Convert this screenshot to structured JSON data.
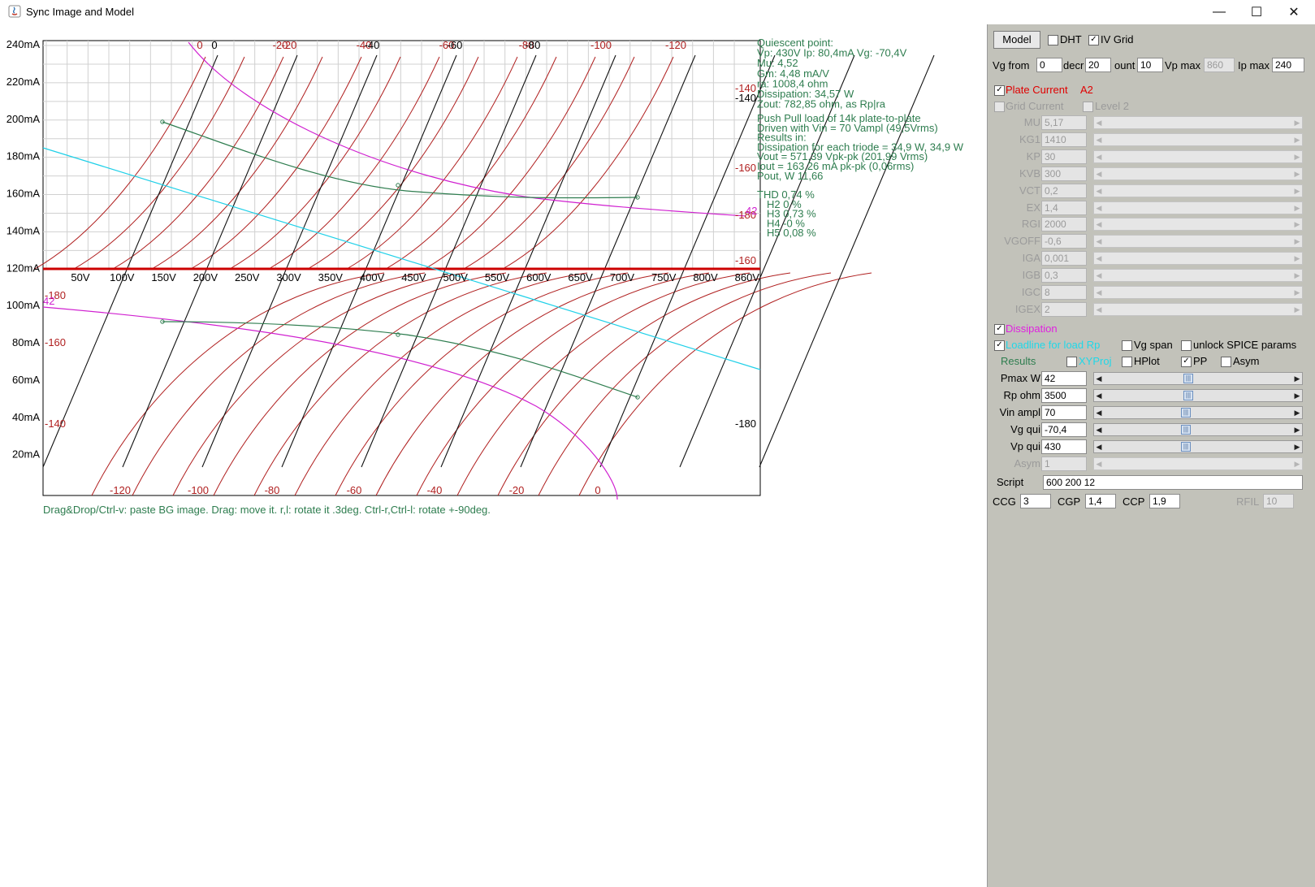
{
  "window": {
    "title": "Sync Image and Model",
    "minimize_label": "—",
    "maximize_label": "☐",
    "close_label": "✕"
  },
  "chart": {
    "y_ticks": [
      "240mA",
      "220mA",
      "200mA",
      "180mA",
      "160mA",
      "140mA",
      "120mA",
      "100mA",
      "80mA",
      "60mA",
      "40mA",
      "20mA"
    ],
    "x_ticks": [
      "50V",
      "100V",
      "150V",
      "200V",
      "250V",
      "300V",
      "350V",
      "400V",
      "450V",
      "500V",
      "550V",
      "600V",
      "650V",
      "700V",
      "750V",
      "800V",
      "860V"
    ],
    "top_curve_labels": [
      "0",
      "0",
      "-20",
      "-20",
      "-40",
      "-40",
      "-60",
      "-60",
      "-80",
      "-80",
      "-100",
      "-120"
    ],
    "right_curve_labels": [
      "-140",
      "-140",
      "-160",
      "-180",
      "-160",
      "-180"
    ],
    "right_magenta_label": "42",
    "bottom_curve_labels": [
      "-120",
      "-100",
      "-80",
      "-60",
      "-40",
      "-20",
      "0"
    ],
    "left_curve_labels": [
      "-180",
      "-160",
      "-140"
    ],
    "left_magenta_label": "42",
    "info_lines": [
      "Quiescent point:",
      "Vp: 430V  Ip: 80,4mA  Vg: -70,4V",
      "Mu: 4,52",
      "Gm: 4,48 mA/V",
      "ra: 1008,4 ohm",
      "Dissipation: 34,57 W",
      "Zout: 782,85 ohm, as Rp|ra"
    ],
    "pp_lines": [
      "Push Pull load of 14k plate-to-plate",
      "Driven with Vin = 70 Vampl (49,5Vrms)",
      "Results in:",
      "Dissipation for each triode = 34,9 W, 34,9 W",
      "Vout = 571,39 Vpk-pk (201,99 Vrms)",
      "Iout = 163,26 mA pk-pk (0,06rms)",
      "Pout, W        11,66"
    ],
    "thd_lines": [
      "THD 0,74 %",
      "H2 0 %",
      "H3 0,73 %",
      "H4 -0 %",
      "H5 0,08 %"
    ],
    "status_text": "Drag&Drop/Ctrl-v: paste BG image. Drag: move it. r,l: rotate it .3deg. Ctrl-r,Ctrl-l: rotate +-90deg."
  },
  "panel": {
    "model_button": "Model",
    "dht_label": "DHT",
    "dht_checked": false,
    "ivgrid_label": "IV Grid",
    "ivgrid_checked": true,
    "vg_from_label": "Vg from",
    "vg_from_value": "0",
    "decr_label": "decr",
    "decr_value": "20",
    "count_label": "ount",
    "count_value": "10",
    "vp_max_label": "Vp max",
    "vp_max_value": "860",
    "ip_max_label": "Ip max",
    "ip_max_value": "240",
    "plate_current_label": "Plate Current",
    "plate_current_checked": true,
    "plate_current_tube": "A2",
    "grid_current_label": "Grid Current",
    "level2_label": "Level 2",
    "params": [
      {
        "name": "MU",
        "value": "5,17"
      },
      {
        "name": "KG1",
        "value": "1410"
      },
      {
        "name": "KP",
        "value": "30"
      },
      {
        "name": "KVB",
        "value": "300"
      },
      {
        "name": "VCT",
        "value": "0,2"
      },
      {
        "name": "EX",
        "value": "1,4"
      },
      {
        "name": "RGI",
        "value": "2000"
      },
      {
        "name": "VGOFF",
        "value": "-0,6"
      },
      {
        "name": "IGA",
        "value": "0,001"
      },
      {
        "name": "IGB",
        "value": "0,3"
      },
      {
        "name": "IGC",
        "value": "8"
      },
      {
        "name": "IGEX",
        "value": "2"
      }
    ],
    "dissipation_label": "Dissipation",
    "dissipation_checked": true,
    "loadline_label": "Loadline for load Rp",
    "loadline_checked": true,
    "vg_span_label": "Vg span",
    "unlock_label": "unlock SPICE params",
    "results_label": "Results",
    "xyproj_label": "XYProj",
    "hplot_label": "HPlot",
    "pp_label": "PP",
    "pp_checked": true,
    "asym_label": "Asym",
    "sliders": [
      {
        "name": "Pmax W",
        "value": "42",
        "pos": 0.42,
        "enabled": true
      },
      {
        "name": "Rp ohm",
        "value": "3500",
        "pos": 0.42,
        "enabled": true
      },
      {
        "name": "Vin ampl",
        "value": "70",
        "pos": 0.41,
        "enabled": true
      },
      {
        "name": "Vg qui",
        "value": "-70,4",
        "pos": 0.41,
        "enabled": true
      },
      {
        "name": "Vp qui",
        "value": "430",
        "pos": 0.41,
        "enabled": true
      },
      {
        "name": "Asym",
        "value": "1",
        "pos": 0.0,
        "enabled": false
      }
    ],
    "script_label": "Script",
    "script_value": "600 200 12",
    "ccg_label": "CCG",
    "ccg_value": "3",
    "cgp_label": "CGP",
    "cgp_value": "1,4",
    "ccp_label": "CCP",
    "ccp_value": "1,9",
    "rfil_label": "RFIL",
    "rfil_value": "10"
  }
}
